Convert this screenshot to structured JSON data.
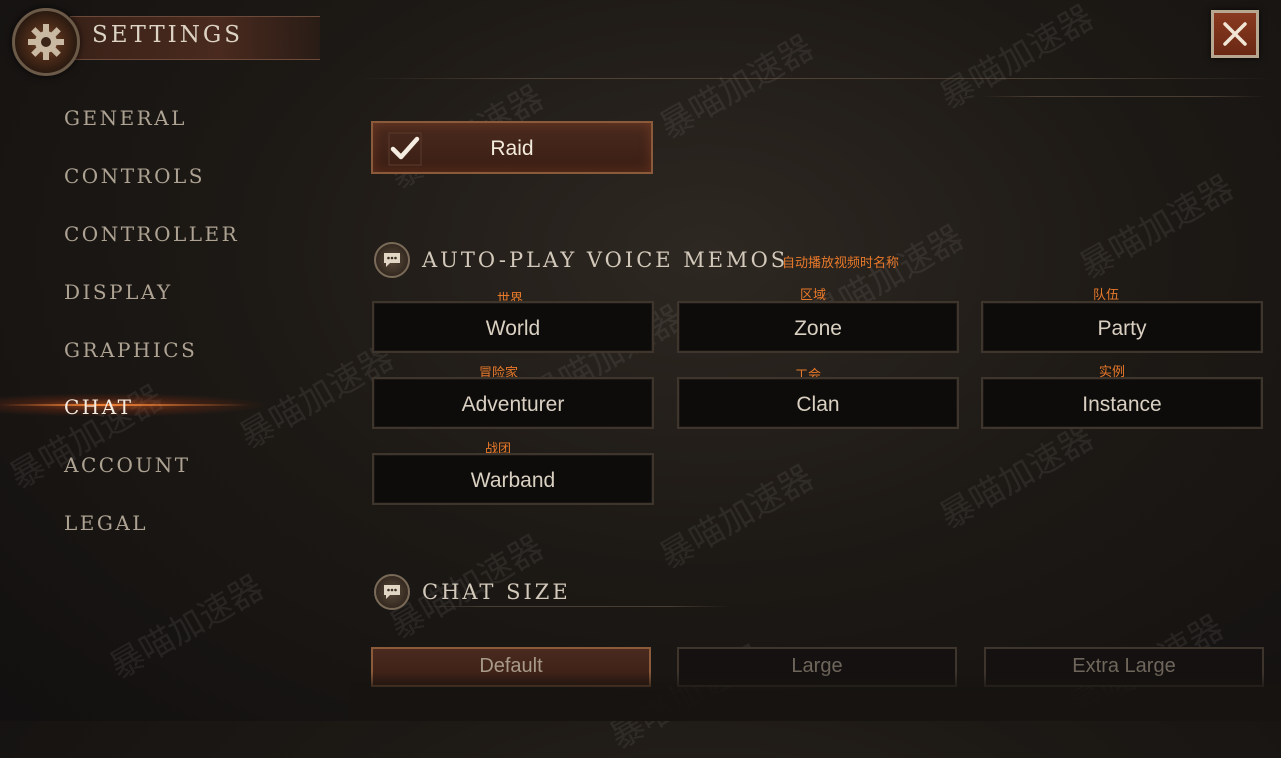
{
  "header": {
    "title": "SETTINGS"
  },
  "icons": {
    "settings": "gear-icon",
    "close": "close-icon",
    "check": "check-icon",
    "section": "chat-bubble-icon"
  },
  "sidebar": {
    "items": [
      {
        "label": "GENERAL"
      },
      {
        "label": "CONTROLS"
      },
      {
        "label": "CONTROLLER"
      },
      {
        "label": "DISPLAY"
      },
      {
        "label": "GRAPHICS"
      },
      {
        "label": "CHAT",
        "active": true
      },
      {
        "label": "ACCOUNT"
      },
      {
        "label": "LEGAL"
      }
    ]
  },
  "raid_toggle": {
    "label": "Raid",
    "checked": true
  },
  "voice_memos": {
    "title": "AUTO-PLAY VOICE MEMOS",
    "annotation": "自动播放视频时名称",
    "options": [
      {
        "label": "World",
        "annotation": "世界"
      },
      {
        "label": "Zone",
        "annotation": "区域"
      },
      {
        "label": "Party",
        "annotation": "队伍"
      },
      {
        "label": "Adventurer",
        "annotation": "冒险家"
      },
      {
        "label": "Clan",
        "annotation": "工会"
      },
      {
        "label": "Instance",
        "annotation": "实例"
      },
      {
        "label": "Warband",
        "annotation": "战团"
      }
    ]
  },
  "chat_size": {
    "title": "CHAT SIZE",
    "options": [
      {
        "label": "Default",
        "selected": true
      },
      {
        "label": "Large"
      },
      {
        "label": "Extra Large"
      }
    ]
  },
  "watermark": "暴喵加速器",
  "colors": {
    "accent": "#e8792a",
    "active_glow": "#ff8c3c",
    "selected_bg": "#4a2a1e"
  }
}
